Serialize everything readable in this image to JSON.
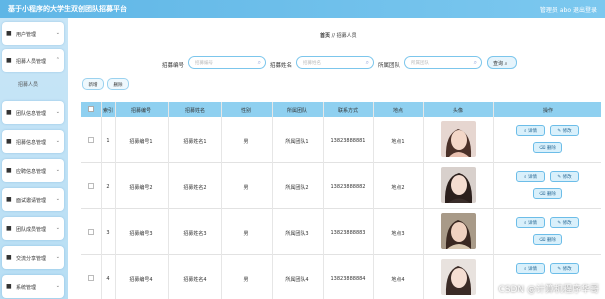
{
  "header": {
    "title": "基于小程序的大学生双创团队招募平台",
    "user_label": "管理员 abo",
    "logout": "退出登录"
  },
  "sidebar": {
    "items": [
      {
        "label": "用户管理",
        "icon": "folder-icon"
      },
      {
        "label": "招募人员管理",
        "icon": "folder-icon",
        "open": true,
        "sub": "招募人员"
      },
      {
        "label": "团队信息管理",
        "icon": "folder-icon"
      },
      {
        "label": "招募信息管理",
        "icon": "folder-icon"
      },
      {
        "label": "应聘信息管理",
        "icon": "folder-icon"
      },
      {
        "label": "面试邀请管理",
        "icon": "folder-icon"
      },
      {
        "label": "团队成员管理",
        "icon": "folder-icon"
      },
      {
        "label": "交流分享管理",
        "icon": "folder-icon"
      },
      {
        "label": "系统管理",
        "icon": "folder-icon"
      }
    ]
  },
  "breadcrumb": {
    "home": "首页",
    "sep": "//",
    "current": "招募人员"
  },
  "search": {
    "fields": [
      {
        "label": "招募编号",
        "placeholder": "招募编号"
      },
      {
        "label": "招募姓名",
        "placeholder": "招募姓名"
      },
      {
        "label": "所属团队",
        "placeholder": "所属团队"
      }
    ],
    "button": "查询"
  },
  "actions": {
    "add": "新增",
    "delete": "删除"
  },
  "table": {
    "headers": [
      "索引",
      "招募编号",
      "招募姓名",
      "性别",
      "所属团队",
      "联系方式",
      "地点",
      "头像",
      "操作"
    ],
    "rows": [
      {
        "index": "1",
        "code": "招募编号1",
        "name": "招募姓名1",
        "gender": "男",
        "team": "所属团队1",
        "phone": "13823888881",
        "place": "地点1"
      },
      {
        "index": "2",
        "code": "招募编号2",
        "name": "招募姓名2",
        "gender": "男",
        "team": "所属团队2",
        "phone": "13823888882",
        "place": "地点2"
      },
      {
        "index": "3",
        "code": "招募编号3",
        "name": "招募姓名3",
        "gender": "男",
        "team": "所属团队3",
        "phone": "13823888883",
        "place": "地点3"
      },
      {
        "index": "4",
        "code": "招募编号4",
        "name": "招募姓名4",
        "gender": "男",
        "team": "所属团队4",
        "phone": "13823888884",
        "place": "地点4"
      }
    ],
    "ops": {
      "detail": "详情",
      "edit": "修改",
      "delete": "删除"
    }
  },
  "watermark": "CSDN @计算机程序华哥",
  "colors": {
    "header": "#6fc0ea",
    "sidebar": "#c4e4f6",
    "table_header": "#8fd0f0",
    "accent": "#6cbde8"
  }
}
